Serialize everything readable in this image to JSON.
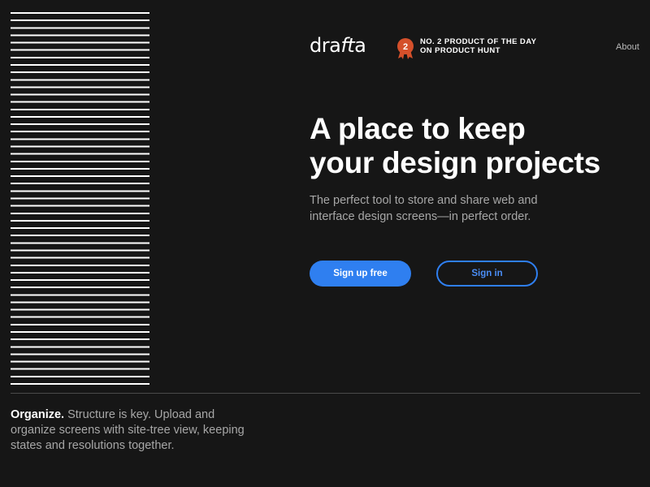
{
  "brand": {
    "logo_prefix": "dra",
    "logo_italic": "ft",
    "logo_suffix": "a",
    "logo_text": "drafta"
  },
  "badge": {
    "rank": "2",
    "line1": "NO. 2 PRODUCT OF THE DAY",
    "line2": "ON PRODUCT HUNT",
    "medal_color": "#d4502b",
    "icon": "medal-icon"
  },
  "nav": {
    "about_label": "About"
  },
  "hero": {
    "title_line1": "A place to keep",
    "title_line2": "your design projects",
    "subtitle_line1": "The perfect tool to store and share web and",
    "subtitle_line2": "interface design screens—in perfect order."
  },
  "actions": {
    "signup_label": "Sign up free",
    "signin_label": "Sign in"
  },
  "feature": {
    "title": "Organize.",
    "body": " Structure is key. Upload and organize screens with site-tree view, keeping states and resolutions together."
  },
  "colors": {
    "background": "#161616",
    "accent": "#2f7ff0",
    "text_primary": "#ffffff",
    "text_secondary": "#a7a7a7",
    "badge_medal": "#d4502b"
  }
}
